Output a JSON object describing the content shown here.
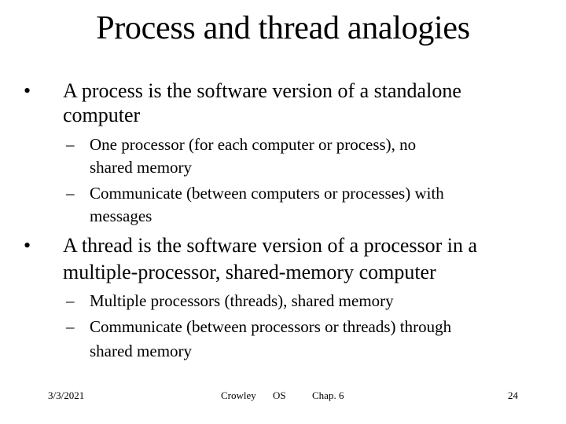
{
  "slide": {
    "title": "Process and thread analogies",
    "bullets": [
      {
        "marker": "•",
        "lines": [
          "A process is the software version of a standalone",
          "computer"
        ],
        "subitems": [
          {
            "marker": "–",
            "lines": [
              "One processor (for each computer or process), no",
              "shared memory"
            ]
          },
          {
            "marker": "–",
            "lines": [
              "Communicate (between computers or processes) with",
              "messages"
            ]
          }
        ]
      },
      {
        "marker": "•",
        "lines": [
          "A thread is the software version of a processor in a",
          "multiple-processor, shared-memory computer"
        ],
        "subitems": [
          {
            "marker": "–",
            "lines": [
              "Multiple processors (threads), shared memory"
            ]
          },
          {
            "marker": "–",
            "lines": [
              "Communicate (between processors or threads) through",
              "shared memory"
            ]
          }
        ]
      }
    ]
  },
  "footer": {
    "date": "3/3/2021",
    "author": "Crowley",
    "course": "OS",
    "chapter": "Chap. 6",
    "page_number": "24"
  }
}
